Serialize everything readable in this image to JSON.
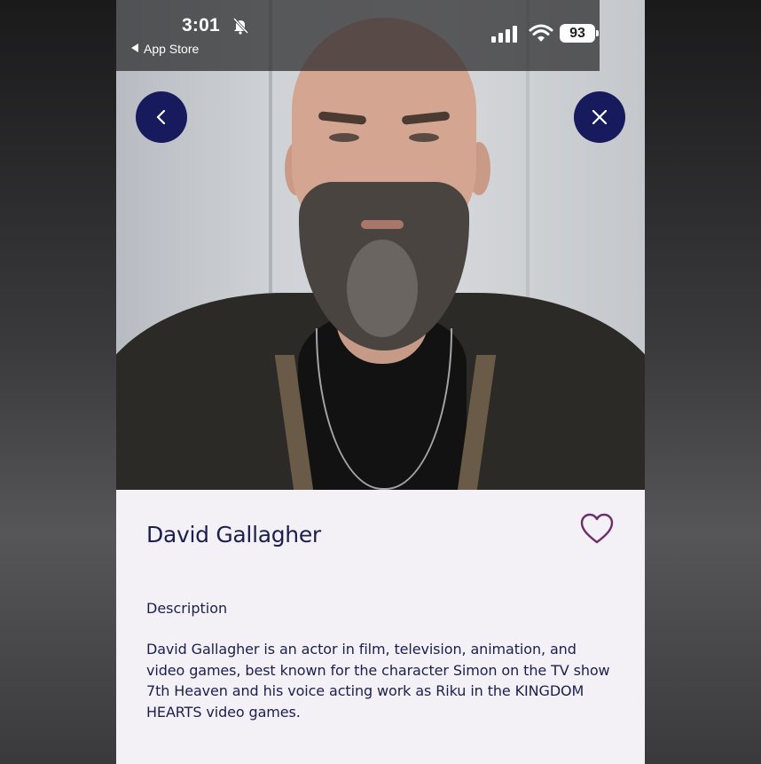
{
  "status_bar": {
    "time": "3:01",
    "back_app_label": "App Store",
    "battery_level": "93"
  },
  "nav": {
    "back_icon": "chevron-left-icon",
    "close_icon": "close-icon",
    "button_color": "#171a5c"
  },
  "profile": {
    "name": "David Gallagher",
    "favorite_icon": "heart-outline-icon",
    "favorite_color": "#6b2f6e",
    "description_label": "Description",
    "description_text": "David Gallagher is an actor in film, television, animation, and video games, best known for the character Simon on the TV show 7th Heaven and his voice acting work as Riku in the KINGDOM HEARTS video games."
  }
}
